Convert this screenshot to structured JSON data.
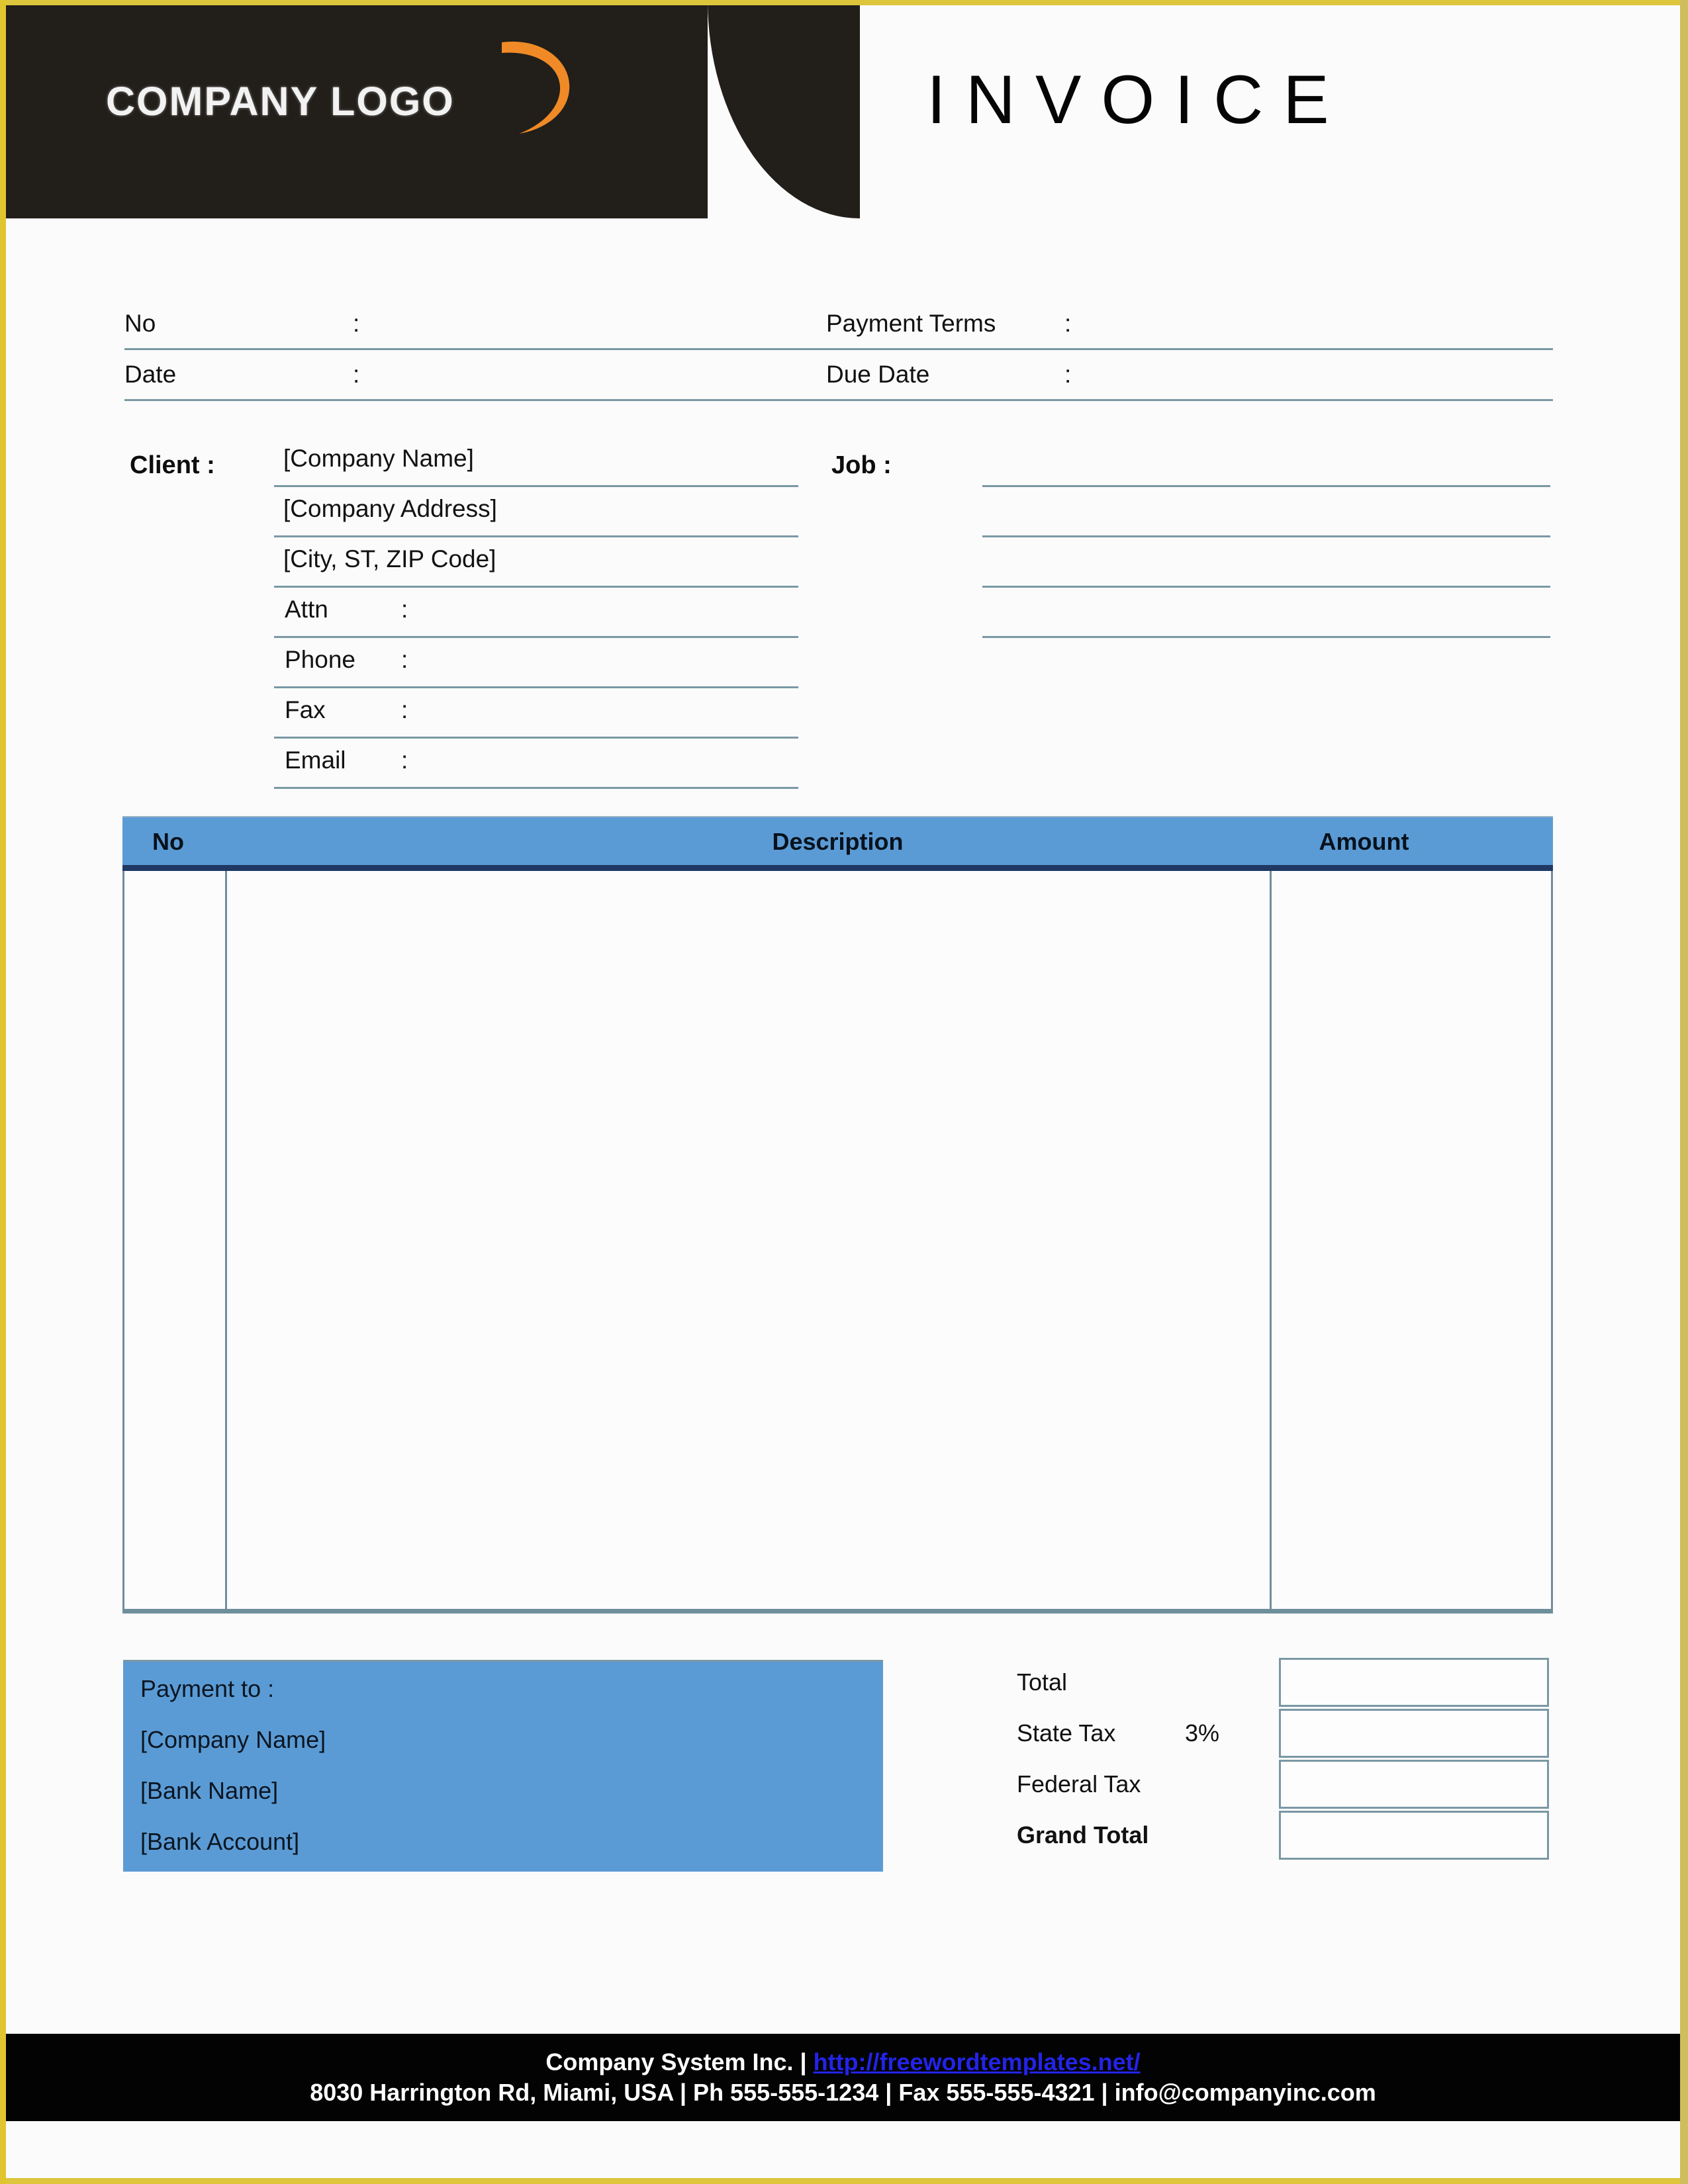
{
  "document": {
    "title": "INVOICE",
    "logo_text": "COMPANY LOGO"
  },
  "colors": {
    "header_black": "#221e1a",
    "accent_blue": "#5b9bd5",
    "header_underline_navy": "#1f3864",
    "rule_gray_blue": "#7a98a4",
    "page_frame_gold": "#ddc53c",
    "footer_black": "#030303",
    "link_blue": "#2323e8",
    "logo_swoosh_orange": "#ef8a26"
  },
  "meta": {
    "rows": [
      {
        "left_label": "No",
        "left_colon": ":",
        "left_value": "",
        "right_label": "Payment  Terms",
        "right_colon": ":",
        "right_value": ""
      },
      {
        "left_label": "Date",
        "left_colon": ":",
        "left_value": "",
        "right_label": "Due Date",
        "right_colon": ":",
        "right_value": ""
      }
    ]
  },
  "client": {
    "heading": "Client  :",
    "rows": [
      {
        "type": "text",
        "text": "[Company Name]"
      },
      {
        "type": "text",
        "text": "[Company Address]"
      },
      {
        "type": "text",
        "text": "[City, ST, ZIP Code]"
      },
      {
        "type": "field",
        "label": "Attn",
        "colon": ":",
        "value": ""
      },
      {
        "type": "field",
        "label": "Phone",
        "colon": ":",
        "value": ""
      },
      {
        "type": "field",
        "label": "Fax",
        "colon": ":",
        "value": ""
      },
      {
        "type": "field",
        "label": "Email",
        "colon": ":",
        "value": ""
      }
    ]
  },
  "job": {
    "heading": "Job  :",
    "rows": [
      "",
      "",
      "",
      ""
    ]
  },
  "items_table": {
    "headers": {
      "no": "No",
      "description": "Description",
      "amount": "Amount"
    },
    "rows": []
  },
  "payment_to": {
    "lines": [
      "Payment to :",
      "[Company Name]",
      "[Bank Name]",
      "[Bank Account]"
    ]
  },
  "totals": {
    "rows": [
      {
        "label": "Total",
        "rate": "",
        "value": "",
        "bold": false
      },
      {
        "label": "State Tax",
        "rate": "3%",
        "value": "",
        "bold": false
      },
      {
        "label": "Federal Tax",
        "rate": "",
        "value": "",
        "bold": false
      },
      {
        "label": "Grand Total",
        "rate": "",
        "value": "",
        "bold": true
      }
    ]
  },
  "footer": {
    "line1_prefix": "Company System Inc. | ",
    "line1_url": "http://freewordtemplates.net/",
    "line2": "8030 Harrington Rd, Miami, USA | Ph 555-555-1234 | Fax 555-555-4321 | info@companyinc.com"
  }
}
